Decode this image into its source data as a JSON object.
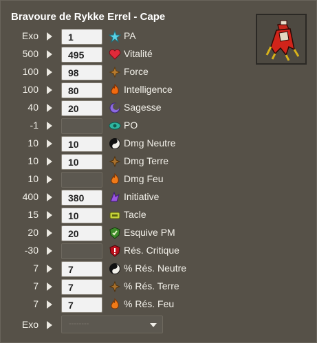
{
  "title": "Bravoure de Rykke Errel - Cape",
  "item_image": "cape-icon",
  "rows": [
    {
      "base": "Exo",
      "value": "1",
      "icon": "pa-star-icon",
      "label": "PA"
    },
    {
      "base": "500",
      "value": "495",
      "icon": "vitality-heart-icon",
      "label": "Vitalité"
    },
    {
      "base": "100",
      "value": "98",
      "icon": "strength-icon",
      "label": "Force"
    },
    {
      "base": "100",
      "value": "80",
      "icon": "intelligence-flame-icon",
      "label": "Intelligence"
    },
    {
      "base": "40",
      "value": "20",
      "icon": "wisdom-moon-icon",
      "label": "Sagesse"
    },
    {
      "base": "-1",
      "value": "",
      "icon": "range-eye-icon",
      "label": "PO"
    },
    {
      "base": "10",
      "value": "10",
      "icon": "neutral-yinyang-icon",
      "label": "Dmg Neutre"
    },
    {
      "base": "10",
      "value": "10",
      "icon": "earth-icon",
      "label": "Dmg Terre"
    },
    {
      "base": "10",
      "value": "",
      "icon": "fire-icon",
      "label": "Dmg Feu"
    },
    {
      "base": "400",
      "value": "380",
      "icon": "initiative-icon",
      "label": "Initiative"
    },
    {
      "base": "15",
      "value": "10",
      "icon": "lock-icon",
      "label": "Tacle"
    },
    {
      "base": "20",
      "value": "20",
      "icon": "dodge-mp-icon",
      "label": "Esquive PM"
    },
    {
      "base": "-30",
      "value": "",
      "icon": "critical-resist-icon",
      "label": "Rés. Critique"
    },
    {
      "base": "7",
      "value": "7",
      "icon": "neutral-yinyang-icon",
      "label": "% Rés. Neutre"
    },
    {
      "base": "7",
      "value": "7",
      "icon": "earth-icon",
      "label": "% Rés. Terre"
    },
    {
      "base": "7",
      "value": "7",
      "icon": "fire-icon",
      "label": "% Rés. Feu"
    }
  ],
  "exo_row": {
    "base": "Exo",
    "select_value": "--------"
  },
  "colors": {
    "background": "#565148",
    "input": "#f2f2f2",
    "text": "#f3f1ea"
  }
}
